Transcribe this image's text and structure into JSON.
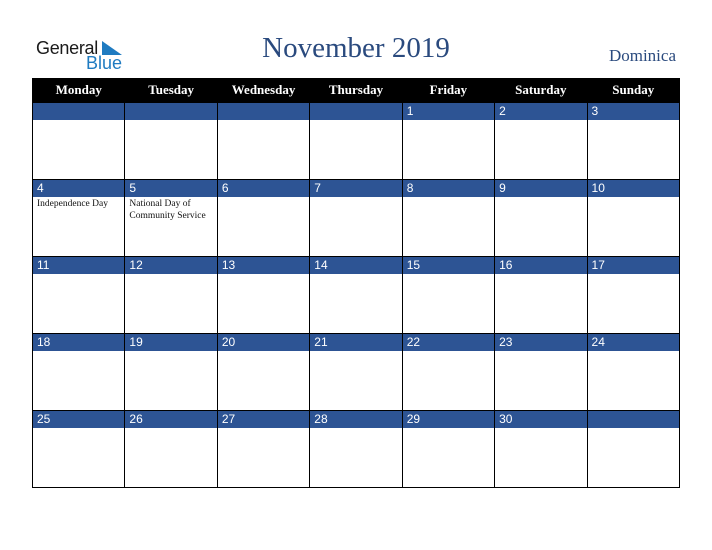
{
  "logo": {
    "line1": "General",
    "line2": "Blue"
  },
  "title": "November 2019",
  "country": "Dominica",
  "colors": {
    "header_bg": "#000000",
    "day_bar": "#2d5494",
    "title": "#2a4a7e",
    "logo_blue": "#1f7bc1"
  },
  "weekdays": [
    "Monday",
    "Tuesday",
    "Wednesday",
    "Thursday",
    "Friday",
    "Saturday",
    "Sunday"
  ],
  "weeks": [
    [
      {
        "day": ""
      },
      {
        "day": ""
      },
      {
        "day": ""
      },
      {
        "day": ""
      },
      {
        "day": "1"
      },
      {
        "day": "2"
      },
      {
        "day": "3"
      }
    ],
    [
      {
        "day": "4",
        "event": "Independence Day"
      },
      {
        "day": "5",
        "event": "National Day of Community Service"
      },
      {
        "day": "6"
      },
      {
        "day": "7"
      },
      {
        "day": "8"
      },
      {
        "day": "9"
      },
      {
        "day": "10"
      }
    ],
    [
      {
        "day": "11"
      },
      {
        "day": "12"
      },
      {
        "day": "13"
      },
      {
        "day": "14"
      },
      {
        "day": "15"
      },
      {
        "day": "16"
      },
      {
        "day": "17"
      }
    ],
    [
      {
        "day": "18"
      },
      {
        "day": "19"
      },
      {
        "day": "20"
      },
      {
        "day": "21"
      },
      {
        "day": "22"
      },
      {
        "day": "23"
      },
      {
        "day": "24"
      }
    ],
    [
      {
        "day": "25"
      },
      {
        "day": "26"
      },
      {
        "day": "27"
      },
      {
        "day": "28"
      },
      {
        "day": "29"
      },
      {
        "day": "30"
      },
      {
        "day": ""
      }
    ]
  ]
}
